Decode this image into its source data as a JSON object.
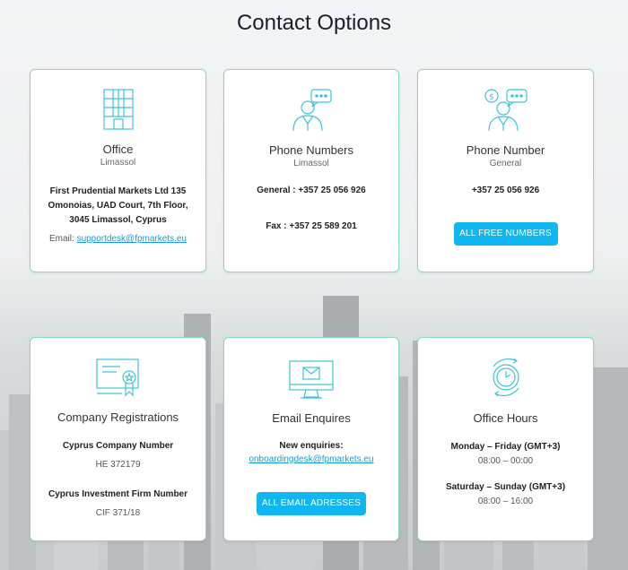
{
  "page": {
    "title": "Contact Options"
  },
  "cards": {
    "office": {
      "title": "Office",
      "subtitle": "Limassol",
      "address_line1": "First Prudential Markets Ltd 135",
      "address_line2": "Omonoias, UAD Court, 7th Floor,",
      "address_line3": "3045 Limassol, Cyprus",
      "email_label": "Email:",
      "email": "supportdesk@fpmarkets.eu",
      "icon": "office-building-icon"
    },
    "phone_limassol": {
      "title": "Phone Numbers",
      "subtitle": "Limassol",
      "general": "General : +357 25 056 926",
      "fax": "Fax : +357 25 589 201",
      "icon": "support-agent-chat-icon"
    },
    "phone_general": {
      "title": "Phone Number",
      "subtitle": "General",
      "number": "+357 25 056 926",
      "button_label": "ALL FREE NUMBERS",
      "icon": "agent-dollar-chat-icon"
    },
    "registrations": {
      "title": "Company Registrations",
      "label1": "Cyprus Company Number",
      "value1": "HE 372179",
      "label2": "Cyprus Investment Firm Number",
      "value2": "CIF 371/18",
      "icon": "certificate-icon"
    },
    "email": {
      "title": "Email Enquires",
      "label": "New enquiries:",
      "address": "onboardingdesk@fpmarkets.eu",
      "button_label": "ALL EMAIL ADRESSES",
      "icon": "monitor-envelope-icon"
    },
    "hours": {
      "title": "Office Hours",
      "label1": "Monday – Friday (GMT+3)",
      "value1": "08:00 – 00:00",
      "label2": "Saturday – Sunday (GMT+3)",
      "value2": "08:00 – 16:00",
      "icon": "clock-icon"
    }
  },
  "colors": {
    "accent": "#10b6ef",
    "icon": "#3ec3d9",
    "border": "#7fdcc0",
    "link": "#1a9ad6"
  }
}
